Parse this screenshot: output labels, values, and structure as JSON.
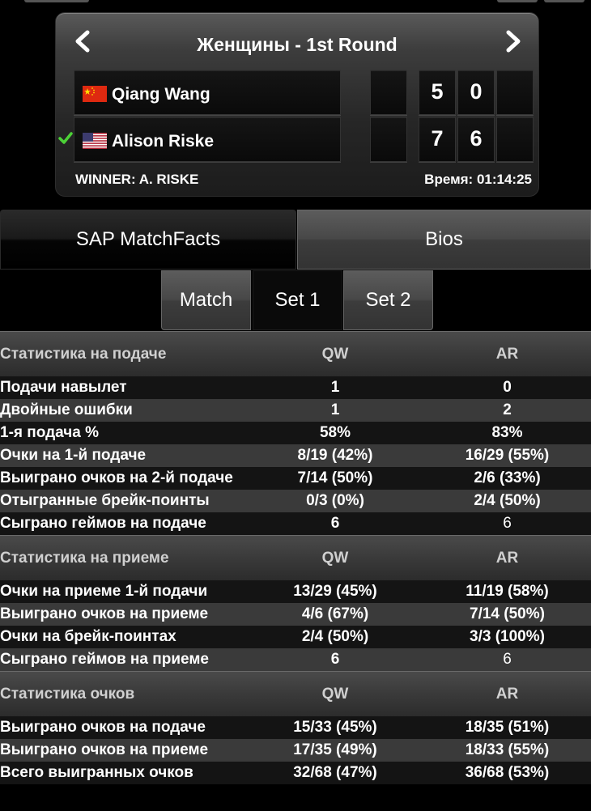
{
  "scoreboard": {
    "round_title": "Женщины - 1st Round",
    "players": [
      {
        "name": "Qiang Wang",
        "flag": "china-flag-icon",
        "sets": [
          "5",
          "0",
          ""
        ],
        "winner": false
      },
      {
        "name": "Alison Riske",
        "flag": "usa-flag-icon",
        "sets": [
          "7",
          "6",
          ""
        ],
        "winner": true
      }
    ],
    "winner_text": "WINNER: A. RISKE",
    "duration_text": "Время: 01:14:25"
  },
  "tabs": {
    "sap": "SAP MatchFacts",
    "bios": "Bios"
  },
  "sub_tabs": {
    "match": "Match",
    "set1": "Set 1",
    "set2": "Set 2"
  },
  "stats": {
    "serve": {
      "header": "Статистика на подаче",
      "qw": "QW",
      "ar": "AR",
      "rows": [
        {
          "label": "Подачи навылет",
          "qw": "1",
          "ar": "0"
        },
        {
          "label": "Двойные ошибки",
          "qw": "1",
          "ar": "2"
        },
        {
          "label": "1-я подача %",
          "qw": "58%",
          "ar": "83%"
        },
        {
          "label": "Очки на 1-й подаче",
          "qw": "8/19 (42%)",
          "ar": "16/29 (55%)"
        },
        {
          "label": "Выиграно очков на 2-й подаче",
          "qw": "7/14 (50%)",
          "ar": "2/6 (33%)"
        },
        {
          "label": "Отыгранные брейк-поинты",
          "qw": "0/3 (0%)",
          "ar": "2/4 (50%)"
        },
        {
          "label": "Сыграно геймов на подаче",
          "qw": "6",
          "ar": "6"
        }
      ]
    },
    "return": {
      "header": "Статистика на приеме",
      "qw": "QW",
      "ar": "AR",
      "rows": [
        {
          "label": "Очки на приеме 1-й подачи",
          "qw": "13/29 (45%)",
          "ar": "11/19 (58%)"
        },
        {
          "label": "Выиграно очков на приеме",
          "qw": "4/6 (67%)",
          "ar": "7/14 (50%)"
        },
        {
          "label": "Очки на брейк-поинтах",
          "qw": "2/4 (50%)",
          "ar": "3/3 (100%)"
        },
        {
          "label": "Сыграно геймов на приеме",
          "qw": "6",
          "ar": "6"
        }
      ]
    },
    "points": {
      "header": "Статистика очков",
      "qw": "QW",
      "ar": "AR",
      "rows": [
        {
          "label": "Выиграно очков на подаче",
          "qw": "15/33 (45%)",
          "ar": "18/35 (51%)"
        },
        {
          "label": "Выиграно очков на приеме",
          "qw": "17/35 (49%)",
          "ar": "18/33 (55%)"
        },
        {
          "label": "Всего выигранных очков",
          "qw": "32/68 (47%)",
          "ar": "36/68 (53%)"
        }
      ]
    }
  }
}
